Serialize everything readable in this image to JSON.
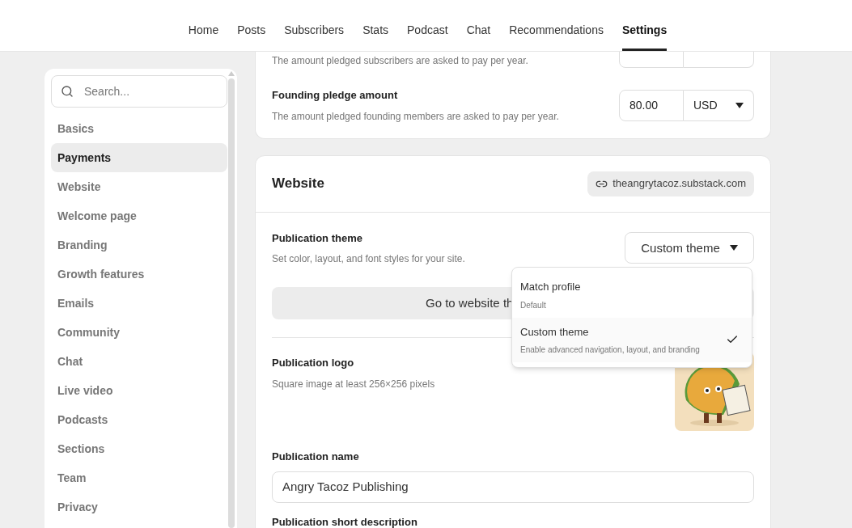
{
  "nav": [
    {
      "label": "Home",
      "selected": false
    },
    {
      "label": "Posts",
      "selected": false
    },
    {
      "label": "Subscribers",
      "selected": false
    },
    {
      "label": "Stats",
      "selected": false
    },
    {
      "label": "Podcast",
      "selected": false
    },
    {
      "label": "Chat",
      "selected": false
    },
    {
      "label": "Recommendations",
      "selected": false
    },
    {
      "label": "Settings",
      "selected": true
    }
  ],
  "sidebar": {
    "search": {
      "placeholder": "Search..."
    },
    "items": [
      {
        "label": "Basics",
        "selected": false
      },
      {
        "label": "Payments",
        "selected": true
      },
      {
        "label": "Website",
        "selected": false
      },
      {
        "label": "Welcome page",
        "selected": false
      },
      {
        "label": "Branding",
        "selected": false
      },
      {
        "label": "Growth features",
        "selected": false
      },
      {
        "label": "Emails",
        "selected": false
      },
      {
        "label": "Community",
        "selected": false
      },
      {
        "label": "Chat",
        "selected": false
      },
      {
        "label": "Live video",
        "selected": false
      },
      {
        "label": "Podcasts",
        "selected": false
      },
      {
        "label": "Sections",
        "selected": false
      },
      {
        "label": "Team",
        "selected": false
      },
      {
        "label": "Privacy",
        "selected": false
      }
    ]
  },
  "payments": {
    "rows": [
      {
        "description": "The amount pledged subscribers are asked to pay per year."
      },
      {
        "title": "Founding pledge amount",
        "description": "The amount pledged founding members are asked to pay per year.",
        "amount": "80.00",
        "currency": "USD"
      }
    ]
  },
  "website": {
    "title": "Website",
    "url": "theangrytacoz.substack.com",
    "theme": {
      "title": "Publication theme",
      "description": "Set color, layout, and font styles for your site.",
      "value": "Custom theme",
      "options": [
        {
          "label": "Match profile",
          "description": "Default",
          "selected": false
        },
        {
          "label": "Custom theme",
          "description": "Enable advanced navigation, layout, and branding",
          "selected": true
        }
      ]
    },
    "editor_button": "Go to website th",
    "logo": {
      "title": "Publication logo",
      "description": "Square image at least 256×256 pixels"
    },
    "name": {
      "title": "Publication name",
      "value": "Angry Tacoz Publishing"
    },
    "short_description": {
      "title": "Publication short description"
    }
  }
}
